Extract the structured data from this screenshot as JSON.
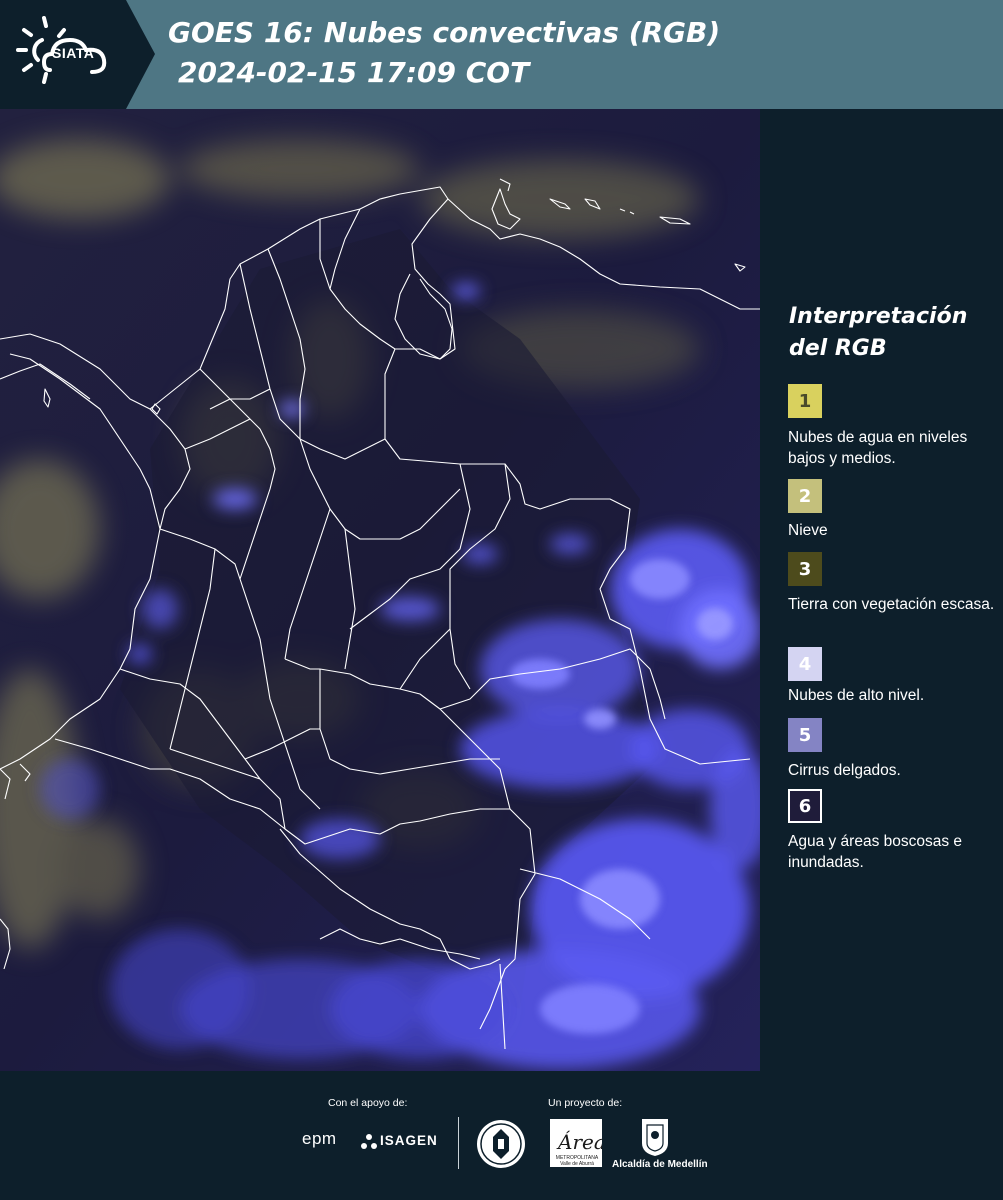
{
  "header": {
    "logo_text": "SIATA",
    "title": "GOES 16: Nubes convectivas (RGB)",
    "subtitle": "2024-02-15 17:09 COT"
  },
  "legend": {
    "title": "Interpretación del RGB",
    "items": [
      {
        "number": "1",
        "label": "Nubes de agua en niveles bajos y medios.",
        "color": "#d9d15e",
        "text_color": "#4a4a2a"
      },
      {
        "number": "2",
        "label": "Nieve",
        "color": "#c4c07c",
        "text_color": "#ffffff"
      },
      {
        "number": "3",
        "label": "Tierra con vegetación escasa.",
        "color": "#4d4b1c",
        "text_color": "#ffffff"
      },
      {
        "number": "4",
        "label": "Nubes de alto nivel.",
        "color": "#d4d4f2",
        "text_color": "#ffffff"
      },
      {
        "number": "5",
        "label": "Cirrus delgados.",
        "color": "#8484c4",
        "text_color": "#ffffff"
      },
      {
        "number": "6",
        "label": "Agua y áreas boscosas e inundadas.",
        "color": "#1f1c3a",
        "text_color": "#ffffff"
      }
    ]
  },
  "footer": {
    "support_label": "Con el apoyo de:",
    "project_label": "Un proyecto de:",
    "sponsor_1": "epm",
    "sponsor_2": "ISAGEN",
    "partner_1": "METROPOLITANA Valle de Aburrá",
    "partner_1_logo": "Área",
    "partner_2": "Alcaldía de Medellín"
  },
  "colors": {
    "background": "#0d1f2b",
    "header": "#4e7684",
    "map_base": "#1e1c44",
    "convective_cloud": "#5c5cff",
    "low_cloud": "#b6ad6e"
  }
}
